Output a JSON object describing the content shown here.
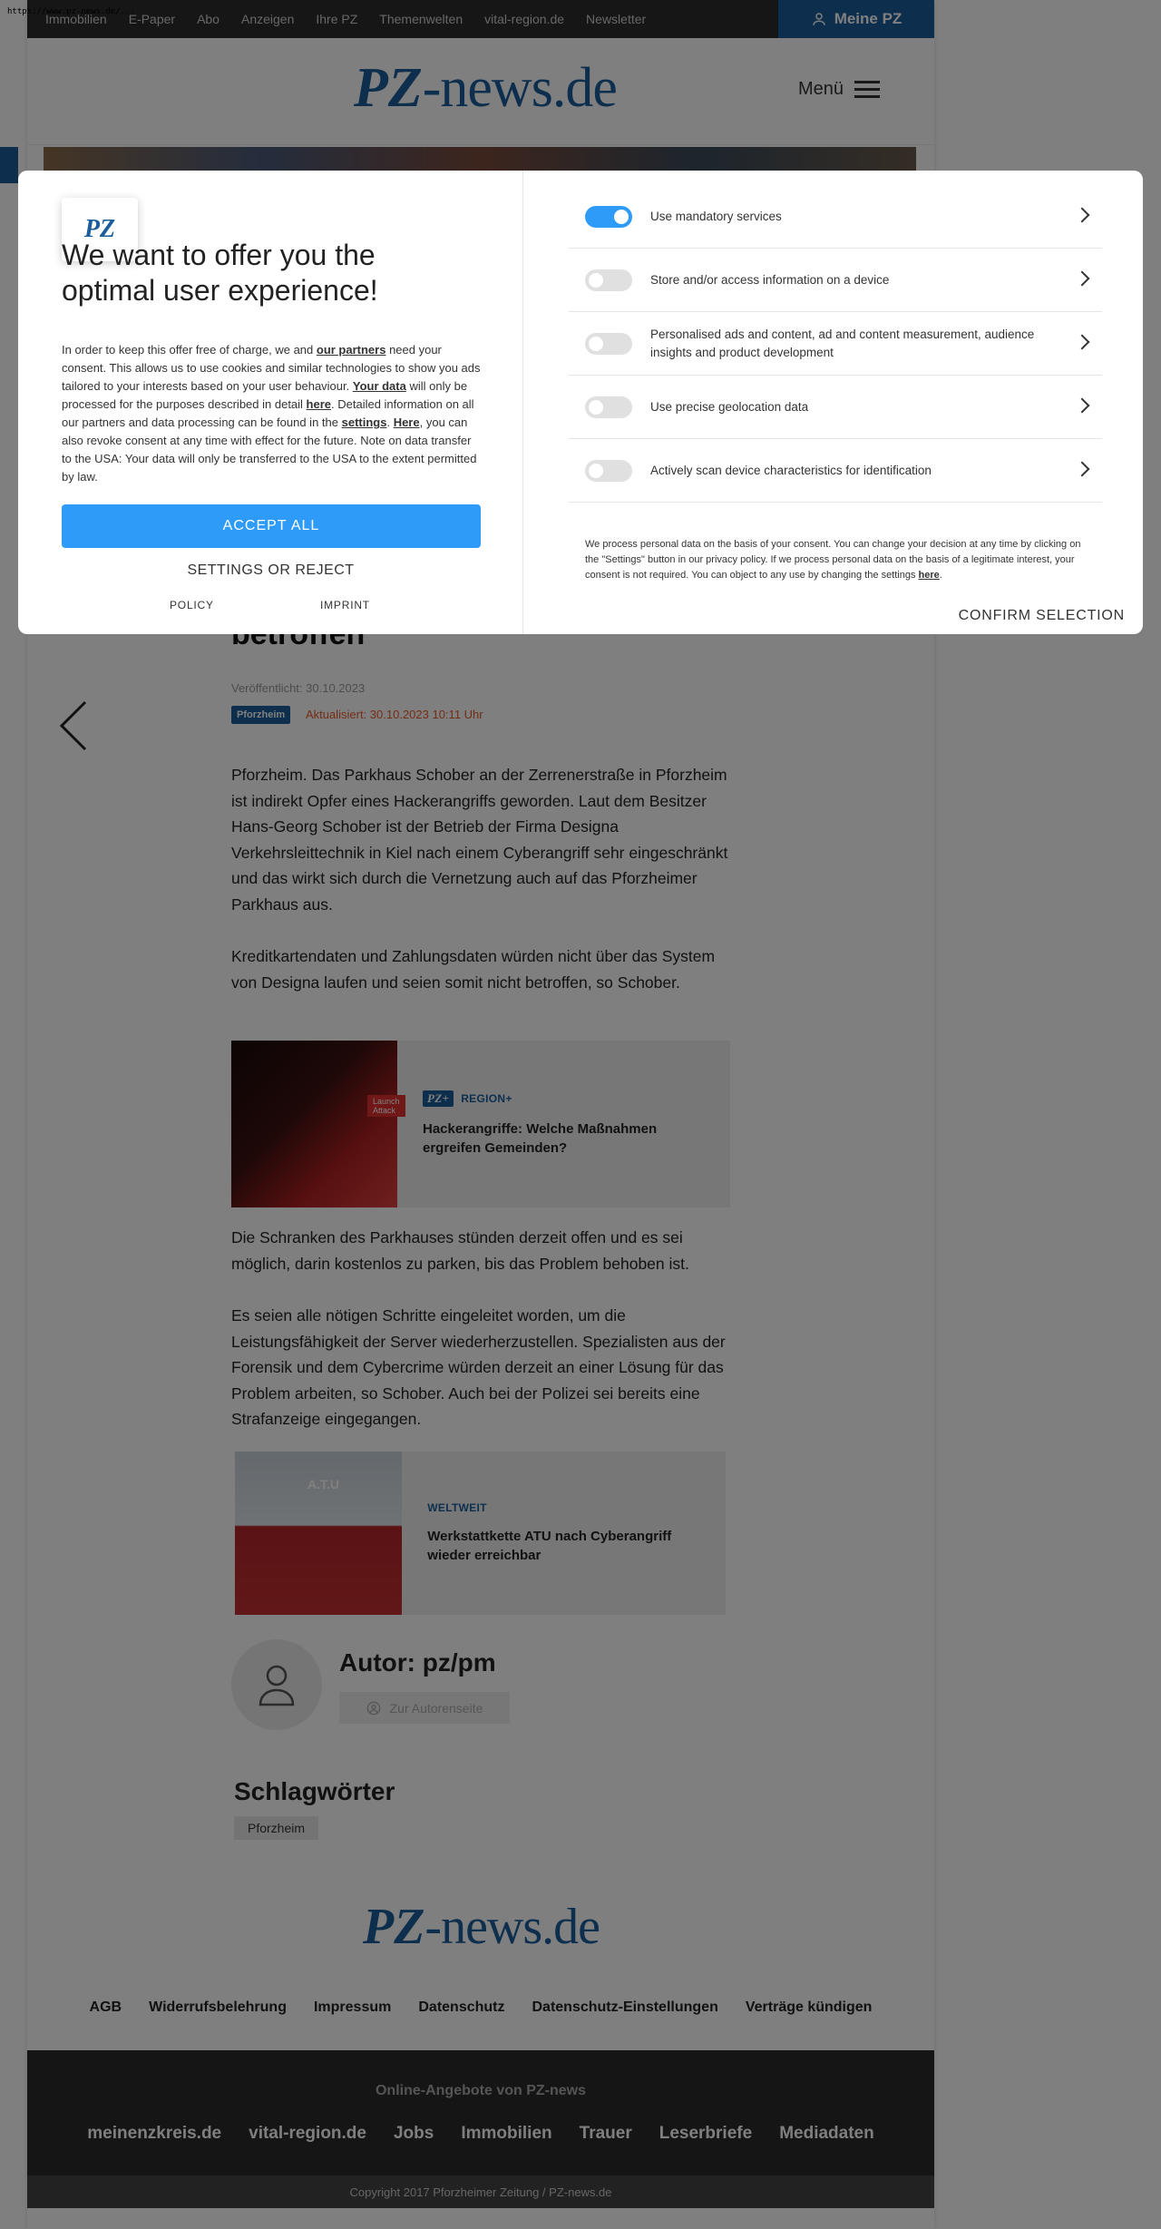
{
  "browser": {
    "url": "https://www.pz-news.de/..."
  },
  "topnav": {
    "items": [
      "Immobilien",
      "E-Paper",
      "Abo",
      "Anzeigen",
      "Ihre PZ",
      "Themenwelten",
      "vital-region.de",
      "Newsletter"
    ],
    "account_label": "Meine PZ"
  },
  "header": {
    "logo_pz": "PZ",
    "logo_rest": "-news.de",
    "menu_label": "Menü"
  },
  "article": {
    "title_tail": "betroffen",
    "published": "Veröffentlicht: 30.10.2023",
    "category": "Pforzheim",
    "updated": "Aktualisiert: 30.10.2023 10:11 Uhr",
    "paragraphs": [
      "Pforzheim. Das Parkhaus Schober an der Zerrenerstraße in Pforzheim ist indirekt Opfer eines Hackerangriffs geworden. Laut dem Besitzer Hans-Georg Schober ist der Betrieb der Firma Designa Verkehrsleittechnik in Kiel nach einem Cyberangriff sehr eingeschränkt und das wirkt sich durch die Vernetzung auch auf das Pforzheimer Parkhaus aus.",
      "Kreditkartendaten und Zahlungsdaten würden nicht über das System von Designa laufen und seien somit nicht betroffen, so Schober.",
      "Die Schranken des Parkhauses stünden derzeit offen und es sei möglich, darin kostenlos zu parken, bis das Problem behoben ist.",
      "Es seien alle nötigen Schritte eingeleitet worden, um die Leistungsfähigkeit der Server wiederherzustellen. Spezialisten aus der Forensik und dem Cybercrime würden derzeit an einer Lösung für das Problem arbeiten, so Schober. Auch bei der Polizei sei bereits eine Strafanzeige eingegangen."
    ],
    "teasers": [
      {
        "badge": "PZ+",
        "kicker": "REGION+",
        "title": "Hackerangriffe: Welche Maßnahmen ergreifen Gemeinden?",
        "image_label": "Launch Attack"
      },
      {
        "kicker": "WELTWEIT",
        "title": "Werkstattkette ATU nach Cyberangriff wieder erreichbar",
        "image_label": "A.T.U"
      }
    ],
    "author_name": "Autor: pz/pm",
    "author_button": "Zur Autorenseite",
    "tags_heading": "Schlagwörter",
    "tags": [
      "Pforzheim"
    ]
  },
  "footer": {
    "links": [
      "AGB",
      "Widerrufsbelehrung",
      "Impressum",
      "Datenschutz",
      "Datenschutz-Einstellungen",
      "Verträge kündigen"
    ],
    "online_heading": "Online-Angebote von PZ-news",
    "online_links": [
      "meinenzkreis.de",
      "vital-region.de",
      "Jobs",
      "Immobilien",
      "Trauer",
      "Leserbriefe",
      "Mediadaten"
    ],
    "copyright": "Copyright 2017 Pforzheimer Zeitung / PZ-news.de"
  },
  "consent": {
    "logo": "PZ",
    "title": "We want to offer you the optimal user experience!",
    "desc_parts": {
      "p1": "In order to keep this offer free of charge, we and ",
      "l1": "our partners",
      "p2": " need your consent. This allows us to use cookies and similar technologies to show you ads tailored to your interests based on your user behaviour. ",
      "l2": "Your data",
      "p3": " will only be processed for the purposes described in detail ",
      "l3": "here",
      "p4": ". Detailed information on all our partners and data processing can be found in the ",
      "l4": "settings",
      "p5": ". ",
      "l5": "Here",
      "p6": ", you can also revoke consent at any time with effect for the future. Note on data transfer to the USA: Your data will only be transferred to the USA to the extent permitted by law."
    },
    "accept_label": "ACCEPT ALL",
    "settings_label": "SETTINGS OR REJECT",
    "policy_label": "POLICY",
    "imprint_label": "IMPRINT",
    "purposes": [
      {
        "label": "Use mandatory services",
        "on": true
      },
      {
        "label": "Store and/or access information on a device",
        "on": false
      },
      {
        "label": "Personalised ads and content, ad and content measurement, audience insights and product development",
        "on": false
      },
      {
        "label": "Use precise geolocation data",
        "on": false
      },
      {
        "label": "Actively scan device characteristics for identification",
        "on": false
      }
    ],
    "note_main": "We process personal data on the basis of your consent. You can change your decision at any time by clicking on the \"Settings\" button in our privacy policy. If we process personal data on the basis of a legitimate interest, your consent is not required. You can object to any use by changing the settings ",
    "note_link": "here",
    "note_end": ".",
    "confirm_label": "CONFIRM SELECTION",
    "colors": {
      "accent": "#2e9bf9",
      "brand": "#1b5e9b"
    }
  }
}
